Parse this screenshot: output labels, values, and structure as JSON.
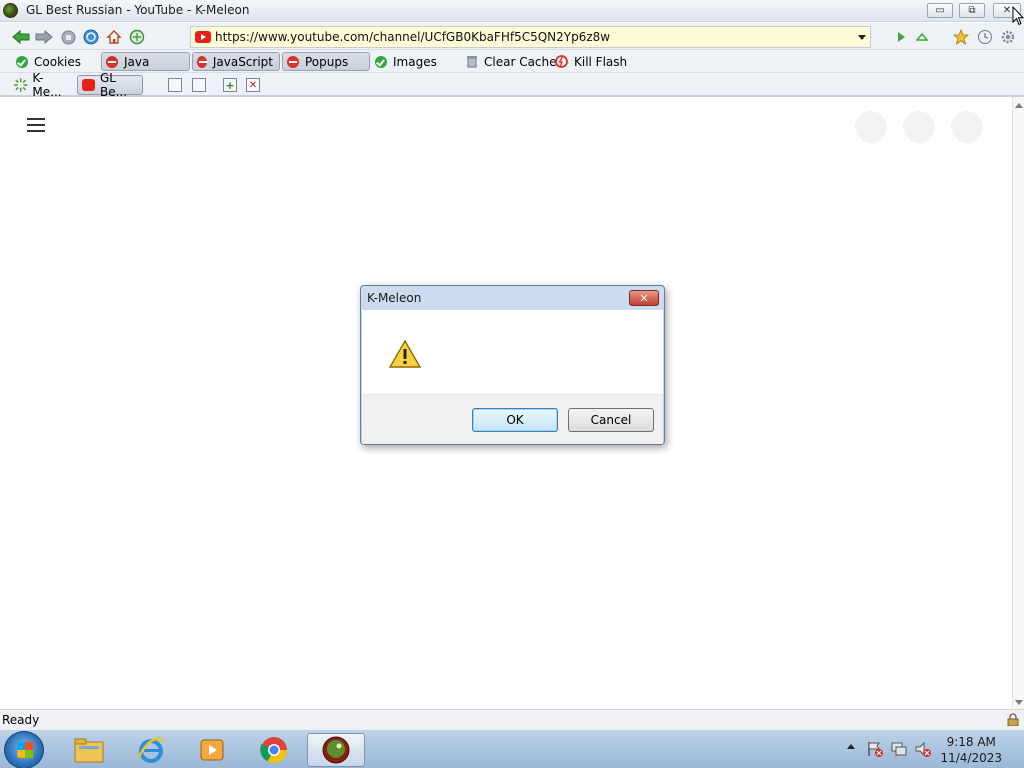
{
  "window": {
    "title": "GL Best Russian - YouTube - K-Meleon",
    "buttons": {
      "minimize": "▭",
      "restore": "⧉",
      "close": "✕"
    }
  },
  "navbar": {
    "url": "https://www.youtube.com/channel/UCfGB0KbaFHf5C5QN2Yp6z8w"
  },
  "privacy_bar": {
    "items": [
      {
        "label": "Cookies",
        "state": "allowed",
        "pressed": false
      },
      {
        "label": "Java",
        "state": "blocked",
        "pressed": true
      },
      {
        "label": "JavaScript",
        "state": "blocked",
        "pressed": true
      },
      {
        "label": "Popups",
        "state": "blocked",
        "pressed": true
      },
      {
        "label": "Images",
        "state": "allowed",
        "pressed": false
      },
      {
        "label": "Clear Cache",
        "state": "action",
        "pressed": false
      },
      {
        "label": "Kill Flash",
        "state": "action",
        "pressed": false
      }
    ]
  },
  "tabs": [
    {
      "label": "K-Me...",
      "icon": "k-meleon-loading-icon",
      "active": false
    },
    {
      "label": "GL Be...",
      "icon": "youtube-icon",
      "active": true
    }
  ],
  "dialog": {
    "title": "K-Meleon",
    "close": "✕",
    "icon": "warning-icon",
    "ok_label": "OK",
    "cancel_label": "Cancel"
  },
  "statusbar": {
    "text": "Ready"
  },
  "taskbar": {
    "time": "9:18 AM",
    "date": "11/4/2023",
    "apps": [
      "file-explorer",
      "internet-explorer",
      "media-player",
      "chrome",
      "k-meleon"
    ],
    "active_app": "k-meleon"
  },
  "colors": {
    "url_background": "#fffbd7",
    "blocked": "#d8322a",
    "allowed": "#2fa83a",
    "youtube_red": "#e62117"
  }
}
